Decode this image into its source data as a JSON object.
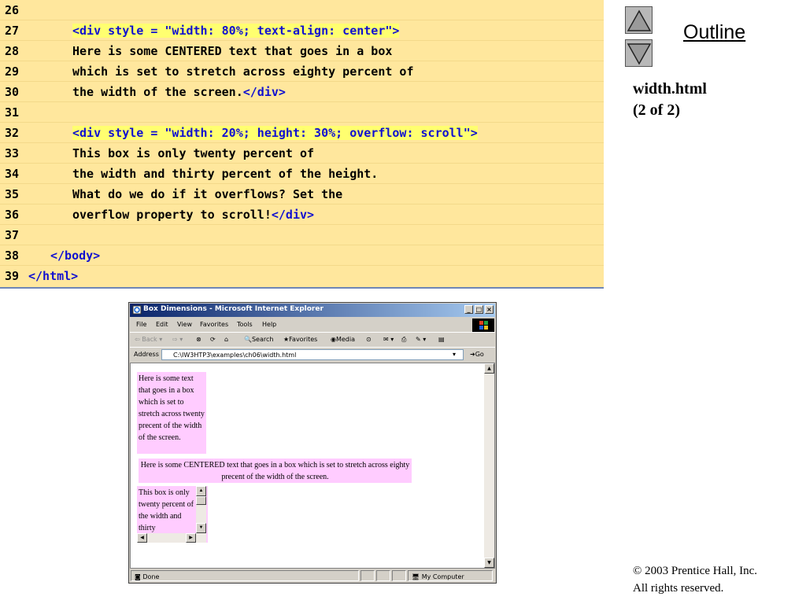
{
  "code_listing": {
    "lines": [
      {
        "num": "26",
        "text": "",
        "kind": "plain",
        "indent": 3
      },
      {
        "num": "27",
        "text": "<div style = \"width: 80%; text-align: center\">",
        "kind": "highlight",
        "indent": 3
      },
      {
        "num": "28",
        "text": "Here is some CENTERED text that goes in a box",
        "kind": "plain",
        "indent": 3
      },
      {
        "num": "29",
        "text": "which is set to stretch across eighty percent of",
        "kind": "plain",
        "indent": 3
      },
      {
        "num": "30",
        "text": "the width of the screen.",
        "tail": "</div>",
        "kind": "plain",
        "indent": 3
      },
      {
        "num": "31",
        "text": "",
        "kind": "plain",
        "indent": 3
      },
      {
        "num": "32",
        "text": "<div style = \"width: 20%; height: 30%; overflow: scroll\">",
        "kind": "highlight",
        "indent": 3
      },
      {
        "num": "33",
        "text": "This box is only twenty percent of",
        "kind": "plain",
        "indent": 3
      },
      {
        "num": "34",
        "text": "the width and thirty percent of the height.",
        "kind": "plain",
        "indent": 3
      },
      {
        "num": "35",
        "text": "What do we do if it overflows? Set the",
        "kind": "plain",
        "indent": 3
      },
      {
        "num": "36",
        "text": "overflow property to scroll!",
        "tail": "</div>",
        "kind": "plain",
        "indent": 3
      },
      {
        "num": "37",
        "text": "",
        "kind": "plain",
        "indent": 3
      },
      {
        "num": "38",
        "text": "</body>",
        "kind": "tag",
        "indent": 2
      },
      {
        "num": "39",
        "text": "</html>",
        "kind": "tag",
        "indent": 1
      }
    ]
  },
  "sidebar": {
    "outline_label": "Outline",
    "file_name": "width.html",
    "page_info": "(2 of 2)",
    "copyright_line1": "© 2003 Prentice Hall, Inc.",
    "copyright_line2": "All rights reserved.",
    "up_icon": "up-triangle-icon",
    "down_icon": "down-triangle-icon"
  },
  "browser": {
    "title": "Box Dimensions - Microsoft Internet Explorer",
    "menu": [
      "File",
      "Edit",
      "View",
      "Favorites",
      "Tools",
      "Help"
    ],
    "toolbar": {
      "back": "Back",
      "search": "Search",
      "favorites": "Favorites",
      "media": "Media"
    },
    "address_label": "Address",
    "address_value": "C:\\IW3HTP3\\examples\\ch06\\width.html",
    "go_label": "Go",
    "status_text": "Done",
    "zone_text": "My Computer",
    "content": {
      "narrow_box": "Here is some text that goes in a box which is set to stretch across twenty precent of the width of the screen.",
      "centered_box": "Here is some CENTERED text that goes in a box which is set to stretch across eighty precent of the width of the screen.",
      "scroll_box": "This box is only twenty percent of the width and thirty"
    }
  }
}
